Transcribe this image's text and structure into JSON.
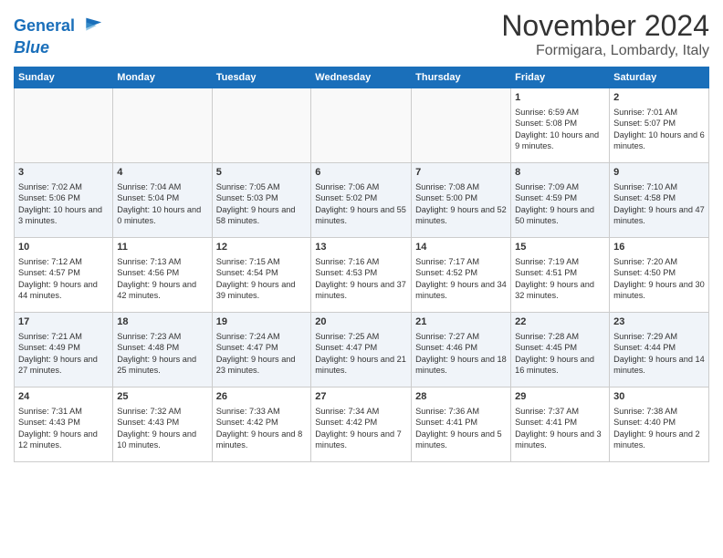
{
  "logo": {
    "line1": "General",
    "line2": "Blue"
  },
  "title": "November 2024",
  "subtitle": "Formigara, Lombardy, Italy",
  "weekdays": [
    "Sunday",
    "Monday",
    "Tuesday",
    "Wednesday",
    "Thursday",
    "Friday",
    "Saturday"
  ],
  "weeks": [
    [
      {
        "day": "",
        "info": ""
      },
      {
        "day": "",
        "info": ""
      },
      {
        "day": "",
        "info": ""
      },
      {
        "day": "",
        "info": ""
      },
      {
        "day": "",
        "info": ""
      },
      {
        "day": "1",
        "info": "Sunrise: 6:59 AM\nSunset: 5:08 PM\nDaylight: 10 hours and 9 minutes."
      },
      {
        "day": "2",
        "info": "Sunrise: 7:01 AM\nSunset: 5:07 PM\nDaylight: 10 hours and 6 minutes."
      }
    ],
    [
      {
        "day": "3",
        "info": "Sunrise: 7:02 AM\nSunset: 5:06 PM\nDaylight: 10 hours and 3 minutes."
      },
      {
        "day": "4",
        "info": "Sunrise: 7:04 AM\nSunset: 5:04 PM\nDaylight: 10 hours and 0 minutes."
      },
      {
        "day": "5",
        "info": "Sunrise: 7:05 AM\nSunset: 5:03 PM\nDaylight: 9 hours and 58 minutes."
      },
      {
        "day": "6",
        "info": "Sunrise: 7:06 AM\nSunset: 5:02 PM\nDaylight: 9 hours and 55 minutes."
      },
      {
        "day": "7",
        "info": "Sunrise: 7:08 AM\nSunset: 5:00 PM\nDaylight: 9 hours and 52 minutes."
      },
      {
        "day": "8",
        "info": "Sunrise: 7:09 AM\nSunset: 4:59 PM\nDaylight: 9 hours and 50 minutes."
      },
      {
        "day": "9",
        "info": "Sunrise: 7:10 AM\nSunset: 4:58 PM\nDaylight: 9 hours and 47 minutes."
      }
    ],
    [
      {
        "day": "10",
        "info": "Sunrise: 7:12 AM\nSunset: 4:57 PM\nDaylight: 9 hours and 44 minutes."
      },
      {
        "day": "11",
        "info": "Sunrise: 7:13 AM\nSunset: 4:56 PM\nDaylight: 9 hours and 42 minutes."
      },
      {
        "day": "12",
        "info": "Sunrise: 7:15 AM\nSunset: 4:54 PM\nDaylight: 9 hours and 39 minutes."
      },
      {
        "day": "13",
        "info": "Sunrise: 7:16 AM\nSunset: 4:53 PM\nDaylight: 9 hours and 37 minutes."
      },
      {
        "day": "14",
        "info": "Sunrise: 7:17 AM\nSunset: 4:52 PM\nDaylight: 9 hours and 34 minutes."
      },
      {
        "day": "15",
        "info": "Sunrise: 7:19 AM\nSunset: 4:51 PM\nDaylight: 9 hours and 32 minutes."
      },
      {
        "day": "16",
        "info": "Sunrise: 7:20 AM\nSunset: 4:50 PM\nDaylight: 9 hours and 30 minutes."
      }
    ],
    [
      {
        "day": "17",
        "info": "Sunrise: 7:21 AM\nSunset: 4:49 PM\nDaylight: 9 hours and 27 minutes."
      },
      {
        "day": "18",
        "info": "Sunrise: 7:23 AM\nSunset: 4:48 PM\nDaylight: 9 hours and 25 minutes."
      },
      {
        "day": "19",
        "info": "Sunrise: 7:24 AM\nSunset: 4:47 PM\nDaylight: 9 hours and 23 minutes."
      },
      {
        "day": "20",
        "info": "Sunrise: 7:25 AM\nSunset: 4:47 PM\nDaylight: 9 hours and 21 minutes."
      },
      {
        "day": "21",
        "info": "Sunrise: 7:27 AM\nSunset: 4:46 PM\nDaylight: 9 hours and 18 minutes."
      },
      {
        "day": "22",
        "info": "Sunrise: 7:28 AM\nSunset: 4:45 PM\nDaylight: 9 hours and 16 minutes."
      },
      {
        "day": "23",
        "info": "Sunrise: 7:29 AM\nSunset: 4:44 PM\nDaylight: 9 hours and 14 minutes."
      }
    ],
    [
      {
        "day": "24",
        "info": "Sunrise: 7:31 AM\nSunset: 4:43 PM\nDaylight: 9 hours and 12 minutes."
      },
      {
        "day": "25",
        "info": "Sunrise: 7:32 AM\nSunset: 4:43 PM\nDaylight: 9 hours and 10 minutes."
      },
      {
        "day": "26",
        "info": "Sunrise: 7:33 AM\nSunset: 4:42 PM\nDaylight: 9 hours and 8 minutes."
      },
      {
        "day": "27",
        "info": "Sunrise: 7:34 AM\nSunset: 4:42 PM\nDaylight: 9 hours and 7 minutes."
      },
      {
        "day": "28",
        "info": "Sunrise: 7:36 AM\nSunset: 4:41 PM\nDaylight: 9 hours and 5 minutes."
      },
      {
        "day": "29",
        "info": "Sunrise: 7:37 AM\nSunset: 4:41 PM\nDaylight: 9 hours and 3 minutes."
      },
      {
        "day": "30",
        "info": "Sunrise: 7:38 AM\nSunset: 4:40 PM\nDaylight: 9 hours and 2 minutes."
      }
    ]
  ]
}
